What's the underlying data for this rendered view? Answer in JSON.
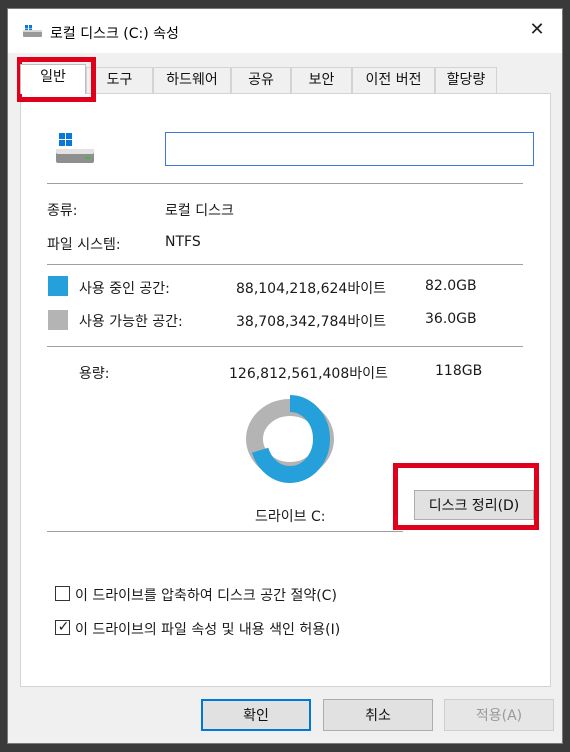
{
  "window": {
    "title": "로컬 디스크 (C:) 속성",
    "close_glyph": "✕"
  },
  "tabs": [
    {
      "label": "일반",
      "active": true
    },
    {
      "label": "도구",
      "active": false
    },
    {
      "label": "하드웨어",
      "active": false
    },
    {
      "label": "공유",
      "active": false
    },
    {
      "label": "보안",
      "active": false
    },
    {
      "label": "이전 버전",
      "active": false
    },
    {
      "label": "할당량",
      "active": false
    }
  ],
  "general": {
    "name_value": "",
    "type_label": "종류:",
    "type_value": "로컬 디스크",
    "fs_label": "파일 시스템:",
    "fs_value": "NTFS",
    "used": {
      "label": "사용 중인 공간:",
      "bytes": "88,104,218,624바이트",
      "size": "82.0GB",
      "color": "#26a0da"
    },
    "free": {
      "label": "사용 가능한 공간:",
      "bytes": "38,708,342,784바이트",
      "size": "36.0GB",
      "color": "#b4b4b4"
    },
    "capacity": {
      "label": "용량:",
      "bytes": "126,812,561,408바이트",
      "size": "118GB"
    },
    "used_fraction": 0.6948,
    "drive_label": "드라이브 C:",
    "cleanup_button": "디스크 정리(D)",
    "compress_checkbox": {
      "label": "이 드라이브를 압축하여 디스크 공간 절약(C)",
      "checked": false
    },
    "index_checkbox": {
      "label": "이 드라이브의 파일 속성 및 내용 색인 허용(I)",
      "checked": true,
      "check_glyph": "✓"
    }
  },
  "footer": {
    "ok": "확인",
    "cancel": "취소",
    "apply": "적용(A)"
  },
  "annotations": {
    "highlight_color": "#e0001b"
  }
}
